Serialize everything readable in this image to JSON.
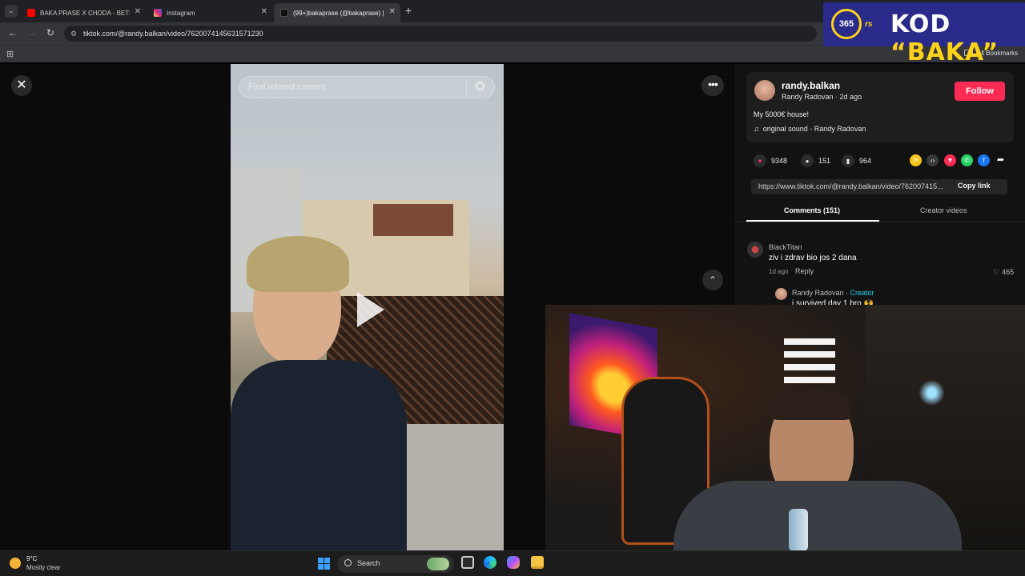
{
  "browser": {
    "tabs": [
      {
        "label": "BAKA PRASE X CHODA - BETMI",
        "favicon_color": "#ff0000"
      },
      {
        "label": "Instagram",
        "favicon_color": "#d62976"
      },
      {
        "label": "(99+)bakaprase (@bakaprase) |",
        "favicon_color": "#111111"
      }
    ],
    "new_tab": "+",
    "url": "tiktok.com/@randy.balkan/video/7620074145631571230",
    "bookmarks_label": "All Bookmarks"
  },
  "ad": {
    "logo_number": "365",
    "logo_suffix": "rs",
    "text_prefix": "KOD ",
    "text_code": "“BAKA”"
  },
  "video": {
    "search_placeholder": "Find related content"
  },
  "panel": {
    "author": {
      "username": "randy.balkan",
      "display_name": "Randy Radovan",
      "posted": "2d ago",
      "follow_label": "Follow"
    },
    "caption": "My 5000€ house!",
    "sound": "original sound - Randy Radovan",
    "stats": {
      "likes": "9348",
      "comments": "151",
      "saves": "964"
    },
    "link": "https://www.tiktok.com/@randy.balkan/video/762007415...",
    "copy_link_label": "Copy link",
    "tabs": {
      "comments": "Comments (151)",
      "creator_videos": "Creator videos"
    },
    "comments": [
      {
        "user": "BlackTitan",
        "text": "ziv i zdrav bio jos 2 dana",
        "age": "1d ago",
        "reply_label": "Reply",
        "likes": "465"
      }
    ],
    "reply": {
      "user": "Randy Radovan",
      "separator": " · ",
      "badge": "Creator",
      "text": "i survived day 1 bro 🙌"
    }
  },
  "taskbar": {
    "temperature": "9°C",
    "condition": "Mostly clear",
    "search_label": "Search"
  },
  "colors": {
    "accent": "#fe2c55",
    "creator_badge": "#20d5ec",
    "ad_background": "#2a2a8a",
    "ad_yellow": "#ffd21a"
  }
}
